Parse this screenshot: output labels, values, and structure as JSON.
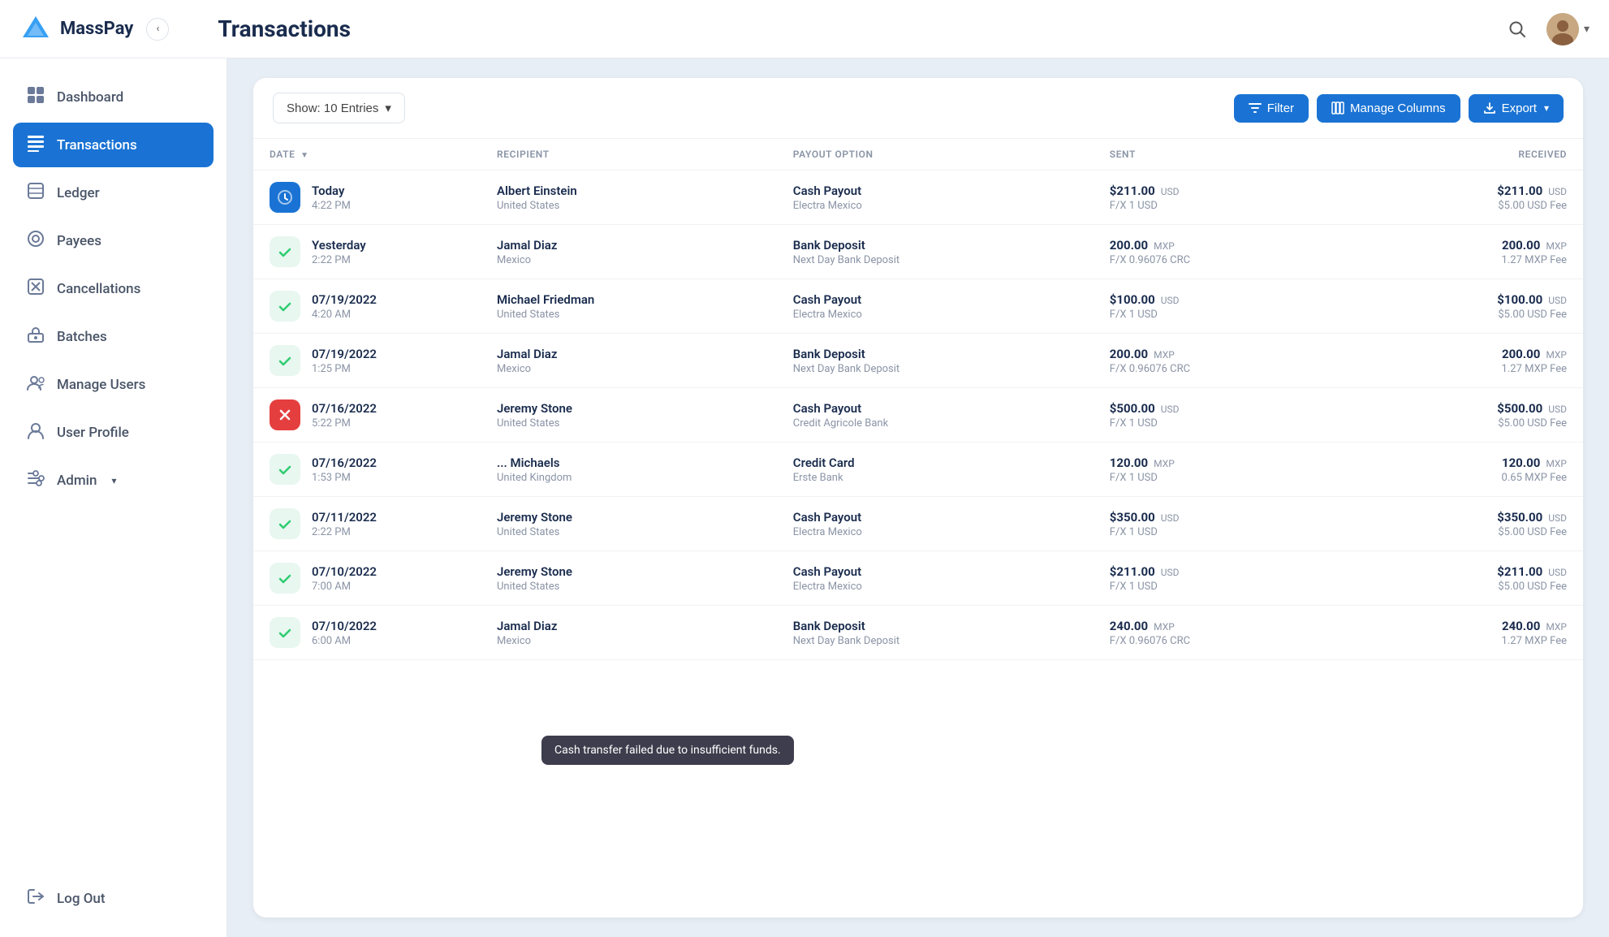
{
  "app": {
    "name": "MassPay"
  },
  "header": {
    "title": "Transactions",
    "search_icon": "🔍",
    "avatar_icon": "👤",
    "sidebar_toggle": "‹"
  },
  "sidebar": {
    "items": [
      {
        "id": "dashboard",
        "label": "Dashboard",
        "icon": "⊞",
        "active": false
      },
      {
        "id": "transactions",
        "label": "Transactions",
        "icon": "≡",
        "active": true
      },
      {
        "id": "ledger",
        "label": "Ledger",
        "icon": "≡",
        "active": false
      },
      {
        "id": "payees",
        "label": "Payees",
        "icon": "◎",
        "active": false
      },
      {
        "id": "cancellations",
        "label": "Cancellations",
        "icon": "✕",
        "active": false
      },
      {
        "id": "batches",
        "label": "Batches",
        "icon": "⊞",
        "active": false
      },
      {
        "id": "manage-users",
        "label": "Manage Users",
        "icon": "👤",
        "active": false
      },
      {
        "id": "user-profile",
        "label": "User Profile",
        "icon": "👤",
        "active": false
      },
      {
        "id": "admin",
        "label": "Admin",
        "icon": "≡",
        "active": false,
        "has_chevron": true
      }
    ],
    "bottom_items": [
      {
        "id": "logout",
        "label": "Log Out",
        "icon": "→"
      }
    ]
  },
  "toolbar": {
    "show_entries_label": "Show: 10 Entries",
    "filter_label": "Filter",
    "manage_columns_label": "Manage Columns",
    "export_label": "Export"
  },
  "table": {
    "columns": [
      {
        "id": "date",
        "label": "DATE",
        "sortable": true
      },
      {
        "id": "recipient",
        "label": "RECIPIENT"
      },
      {
        "id": "payout_option",
        "label": "PAYOUT OPTION"
      },
      {
        "id": "sent",
        "label": "SENT"
      },
      {
        "id": "received",
        "label": "RECEIVED"
      }
    ],
    "rows": [
      {
        "id": 1,
        "status": "pending",
        "date": "Today",
        "time": "4:22 PM",
        "recipient": "Albert Einstein",
        "recipient_country": "United States",
        "payout_option": "Cash Payout",
        "payout_sub": "Electra Mexico",
        "sent_amount": "$211.00",
        "sent_currency": "USD",
        "sent_fx": "F/X 1 USD",
        "received_amount": "$211.00",
        "received_currency": "USD",
        "received_fee": "$5.00 USD Fee"
      },
      {
        "id": 2,
        "status": "success",
        "date": "Yesterday",
        "time": "2:22 PM",
        "recipient": "Jamal Diaz",
        "recipient_country": "Mexico",
        "payout_option": "Bank Deposit",
        "payout_sub": "Next Day Bank Deposit",
        "sent_amount": "200.00",
        "sent_currency": "MXP",
        "sent_fx": "F/X 0.96076 CRC",
        "received_amount": "200.00",
        "received_currency": "MXP",
        "received_fee": "1.27 MXP Fee"
      },
      {
        "id": 3,
        "status": "success",
        "date": "07/19/2022",
        "time": "4:20 AM",
        "recipient": "Michael Friedman",
        "recipient_country": "United States",
        "payout_option": "Cash Payout",
        "payout_sub": "Electra Mexico",
        "sent_amount": "$100.00",
        "sent_currency": "USD",
        "sent_fx": "F/X 1 USD",
        "received_amount": "$100.00",
        "received_currency": "USD",
        "received_fee": "$5.00 USD Fee"
      },
      {
        "id": 4,
        "status": "success",
        "date": "07/19/2022",
        "time": "1:25 PM",
        "recipient": "Jamal Diaz",
        "recipient_country": "Mexico",
        "payout_option": "Bank Deposit",
        "payout_sub": "Next Day Bank Deposit",
        "sent_amount": "200.00",
        "sent_currency": "MXP",
        "sent_fx": "F/X 0.96076 CRC",
        "received_amount": "200.00",
        "received_currency": "MXP",
        "received_fee": "1.27 MXP Fee"
      },
      {
        "id": 5,
        "status": "failed",
        "date": "07/16/2022",
        "time": "5:22 PM",
        "recipient": "Jeremy Stone",
        "recipient_country": "United States",
        "payout_option": "Cash Payout",
        "payout_sub": "Credit Agricole Bank",
        "sent_amount": "$500.00",
        "sent_currency": "USD",
        "sent_fx": "F/X 1 USD",
        "received_amount": "$500.00",
        "received_currency": "USD",
        "received_fee": "$5.00 USD Fee"
      },
      {
        "id": 6,
        "status": "success",
        "date": "07/16/2022",
        "time": "1:53 PM",
        "recipient": "... Michaels",
        "recipient_country": "United Kingdom",
        "payout_option": "Credit Card",
        "payout_sub": "Erste Bank",
        "sent_amount": "120.00",
        "sent_currency": "MXP",
        "sent_fx": "F/X 1 USD",
        "received_amount": "120.00",
        "received_currency": "MXP",
        "received_fee": "0.65 MXP Fee"
      },
      {
        "id": 7,
        "status": "success",
        "date": "07/11/2022",
        "time": "2:22 PM",
        "recipient": "Jeremy Stone",
        "recipient_country": "United States",
        "payout_option": "Cash Payout",
        "payout_sub": "Electra Mexico",
        "sent_amount": "$350.00",
        "sent_currency": "USD",
        "sent_fx": "F/X 1 USD",
        "received_amount": "$350.00",
        "received_currency": "USD",
        "received_fee": "$5.00 USD Fee"
      },
      {
        "id": 8,
        "status": "success",
        "date": "07/10/2022",
        "time": "7:00 AM",
        "recipient": "Jeremy Stone",
        "recipient_country": "United States",
        "payout_option": "Cash Payout",
        "payout_sub": "Electra Mexico",
        "sent_amount": "$211.00",
        "sent_currency": "USD",
        "sent_fx": "F/X 1 USD",
        "received_amount": "$211.00",
        "received_currency": "USD",
        "received_fee": "$5.00 USD Fee"
      },
      {
        "id": 9,
        "status": "success",
        "date": "07/10/2022",
        "time": "6:00 AM",
        "recipient": "Jamal Diaz",
        "recipient_country": "Mexico",
        "payout_option": "Bank Deposit",
        "payout_sub": "Next Day Bank Deposit",
        "sent_amount": "240.00",
        "sent_currency": "MXP",
        "sent_fx": "F/X 0.96076 CRC",
        "received_amount": "240.00",
        "received_currency": "MXP",
        "received_fee": "1.27 MXP Fee"
      }
    ]
  },
  "tooltip": {
    "text": "Cash transfer failed due to insufficient funds."
  }
}
